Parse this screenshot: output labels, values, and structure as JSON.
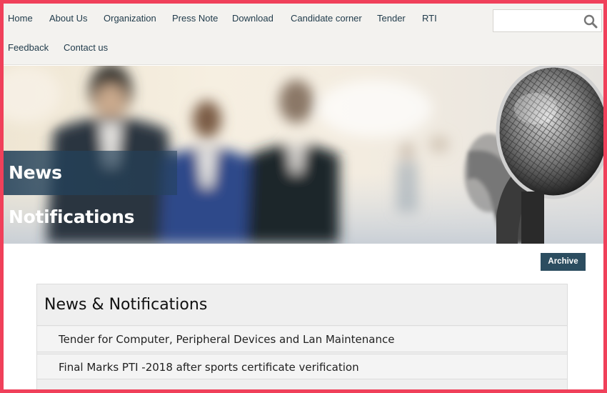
{
  "nav": {
    "items": [
      {
        "label": "Home"
      },
      {
        "label": "About Us"
      },
      {
        "label": "Organization"
      },
      {
        "label": "Press Note"
      },
      {
        "label": "Download"
      },
      {
        "label": "Candidate corner"
      },
      {
        "label": "Tender"
      },
      {
        "label": "RTI"
      },
      {
        "label": "Feedback"
      },
      {
        "label": "Contact us"
      }
    ],
    "search": {
      "value": "",
      "icon": "search-icon"
    }
  },
  "banner": {
    "title": "News Notifications"
  },
  "archive": {
    "label": "Archive"
  },
  "news": {
    "heading": "News & Notifications",
    "items": [
      {
        "title": "Tender for Computer, Peripheral Devices and Lan Maintenance"
      },
      {
        "title": "Final Marks PTI -2018 after sports certificate verification"
      }
    ]
  },
  "colors": {
    "border_accent": "#f0405a",
    "nav_background": "#f3f2ef",
    "nav_text": "#1f3a4a",
    "archive_button": "#2c4d60",
    "banner_title_overlay": "#23415a"
  }
}
